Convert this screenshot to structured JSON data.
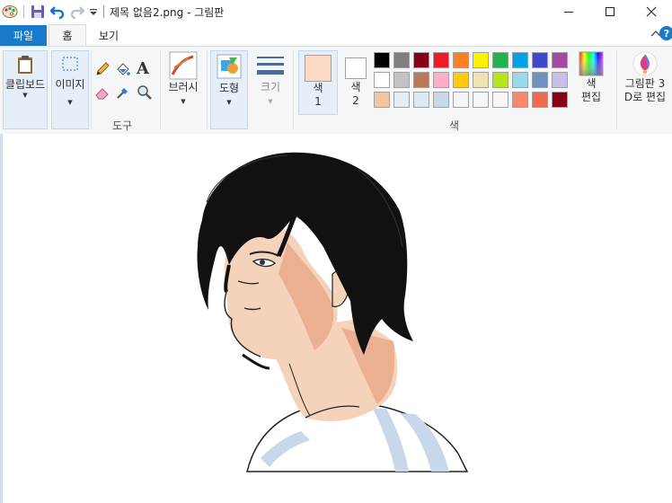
{
  "titlebar": {
    "title": "제목 없음2.png - 그림판"
  },
  "tabs": [
    {
      "label": "파일"
    },
    {
      "label": "홈"
    },
    {
      "label": "보기"
    }
  ],
  "ribbon": {
    "clipboard": {
      "label": "클립보드"
    },
    "image": {
      "label": "이미지"
    },
    "tools": {
      "group_label": "도구"
    },
    "brushes": {
      "label": "브러시"
    },
    "shapes": {
      "label": "도형"
    },
    "size": {
      "label": "크기"
    },
    "color1": {
      "line1": "색",
      "line2": "1",
      "value": "#fcdac5"
    },
    "color2": {
      "line1": "색",
      "line2": "2",
      "value": "#ffffff"
    },
    "palette_label": "색",
    "edit_colors": {
      "line1": "색",
      "line2": "편집"
    },
    "paint3d": {
      "line1": "그림판 3",
      "line2": "D로 편집"
    },
    "palette_rows": [
      [
        "#000000",
        "#7f7f7f",
        "#880015",
        "#ed1c24",
        "#ff7f27",
        "#fff200",
        "#22b14c",
        "#00a2e8",
        "#3f48cc",
        "#a349a4"
      ],
      [
        "#ffffff",
        "#c3c3c3",
        "#b97a57",
        "#ffaec9",
        "#ffc90e",
        "#efe4b0",
        "#b5e61d",
        "#99d9ea",
        "#7092be",
        "#c8bfe7"
      ],
      [
        "#f4c3a0",
        "#e4ecf4",
        "#dde9f3",
        "#c9d8e7",
        "#f4f6f8",
        "#f4f6f8",
        "#f4f6f8",
        "#f9876b",
        "#f26b51",
        "#880015"
      ]
    ]
  },
  "icons": {
    "app": "paint-palette-icon",
    "save": "floppy-disk-icon",
    "undo": "undo-icon",
    "redo": "redo-icon",
    "customize": "dropdown-icon",
    "minimize": "minimize-icon",
    "maximize": "maximize-icon",
    "close": "close-icon"
  }
}
